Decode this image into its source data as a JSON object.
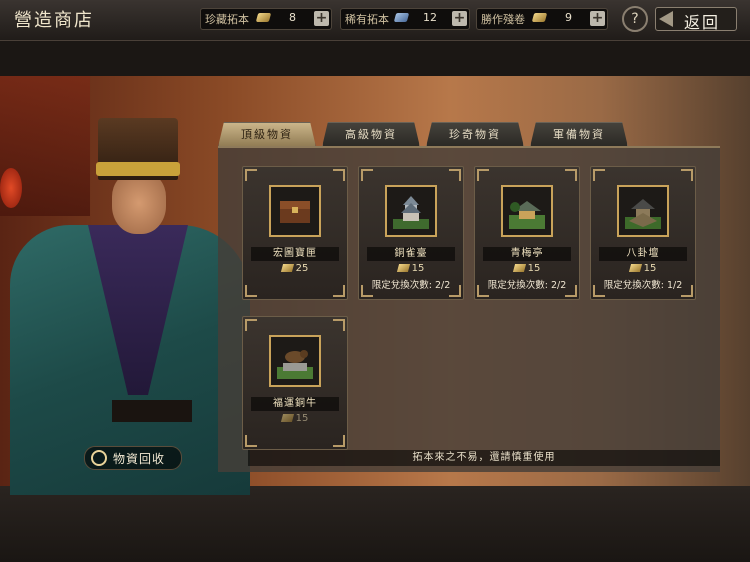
{
  "header": {
    "title": "營造商店",
    "back_label": "返回",
    "help_label": "?"
  },
  "resources": [
    {
      "label": "珍藏拓本",
      "count": "8",
      "icon": "gold-rubbing-icon"
    },
    {
      "label": "稀有拓本",
      "count": "12",
      "icon": "blue-rubbing-icon"
    },
    {
      "label": "勝作殘卷",
      "count": "9",
      "icon": "scroll-icon"
    }
  ],
  "tabs": [
    {
      "label": "頂級物資",
      "active": true
    },
    {
      "label": "高級物資",
      "active": false
    },
    {
      "label": "珍奇物資",
      "active": false
    },
    {
      "label": "軍備物資",
      "active": false
    }
  ],
  "items": [
    {
      "name": "宏圖寶匣",
      "cost": "25",
      "limit": "",
      "icon": "treasure-chest-icon"
    },
    {
      "name": "銅雀臺",
      "cost": "15",
      "limit": "限定兌換次數: 2/2",
      "icon": "pagoda-icon"
    },
    {
      "name": "青梅亭",
      "cost": "15",
      "limit": "限定兌換次數: 2/2",
      "icon": "pavilion-icon"
    },
    {
      "name": "八卦壇",
      "cost": "15",
      "limit": "限定兌換次數: 1/2",
      "icon": "altar-icon"
    },
    {
      "name": "福運銅牛",
      "cost": "15",
      "limit": "",
      "icon": "bronze-ox-icon"
    }
  ],
  "notice": "拓本來之不易，還請慎重使用",
  "recycle_label": "物資回收",
  "colors": {
    "accent_gold": "#c9a35a",
    "panel": "#3b342e"
  }
}
